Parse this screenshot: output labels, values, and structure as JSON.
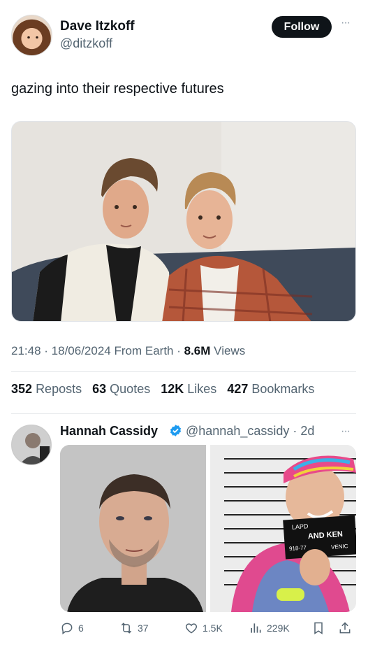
{
  "post": {
    "author_name": "Dave Itzkoff",
    "author_handle": "@ditzkoff",
    "follow_label": "Follow",
    "more_label": "···",
    "text": "gazing into their respective futures",
    "time": "21:48",
    "date": "18/06/2024",
    "source": "From Earth",
    "views_count": "8.6M",
    "views_label": "Views",
    "stats": {
      "reposts_count": "352",
      "reposts_label": "Reposts",
      "quotes_count": "63",
      "quotes_label": "Quotes",
      "likes_count": "12K",
      "likes_label": "Likes",
      "bookmarks_count": "427",
      "bookmarks_label": "Bookmarks"
    }
  },
  "reply": {
    "author_name": "Hannah Cassidy",
    "author_handle": "@hannah_cassidy",
    "age": "2d",
    "more_label": "···",
    "sign_texts": {
      "lapd": "LAPD",
      "and_ken": "AND KEN",
      "number": "918-77",
      "venice": "VENIC"
    },
    "actions": {
      "replies": "6",
      "reposts": "37",
      "likes": "1.5K",
      "views": "229K"
    }
  },
  "colors": {
    "text": "#0f1419",
    "secondary": "#536471",
    "verified": "#1d9bf0",
    "follow_bg": "#0f1419"
  }
}
